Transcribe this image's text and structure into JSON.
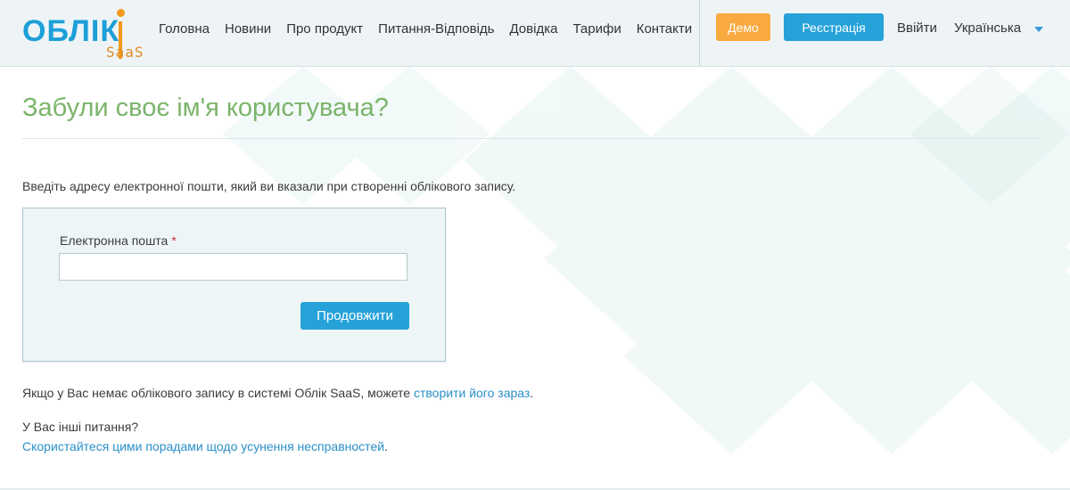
{
  "brand": {
    "logo_main": "ОБЛІК",
    "logo_sub": "SaaS"
  },
  "nav": {
    "items": [
      {
        "label": "Головна"
      },
      {
        "label": "Новини"
      },
      {
        "label": "Про продукт"
      },
      {
        "label": "Питання-Відповідь"
      },
      {
        "label": "Довідка"
      },
      {
        "label": "Тарифи"
      },
      {
        "label": "Контакти"
      }
    ]
  },
  "header": {
    "demo_label": "Демо",
    "register_label": "Реєстрація",
    "logout_label": "Ввійти",
    "language": "Українська"
  },
  "page": {
    "title": "Забули своє ім'я користувача?",
    "intro": "Введіть адресу електронної пошти, який ви вказали при створенні облікового запису."
  },
  "form": {
    "email_label": "Електронна пошта",
    "required_mark": "*",
    "email_value": "",
    "email_placeholder": "",
    "continue_label": "Продовжити"
  },
  "footer_text": {
    "no_account_prefix": "Якщо у Вас немає облікового запису в системі Облік SaaS, можете ",
    "create_link": "створити його зараз",
    "no_account_suffix": ".",
    "other_questions": "У Вас інші питання?",
    "tips_link": "Скористайтеся цими порадами щодо усунення несправностей",
    "tips_suffix": "."
  },
  "colors": {
    "accent": "#26a2d9",
    "demo": "#f8a93f",
    "title": "#7bb46a",
    "link": "#2a8fc9"
  }
}
